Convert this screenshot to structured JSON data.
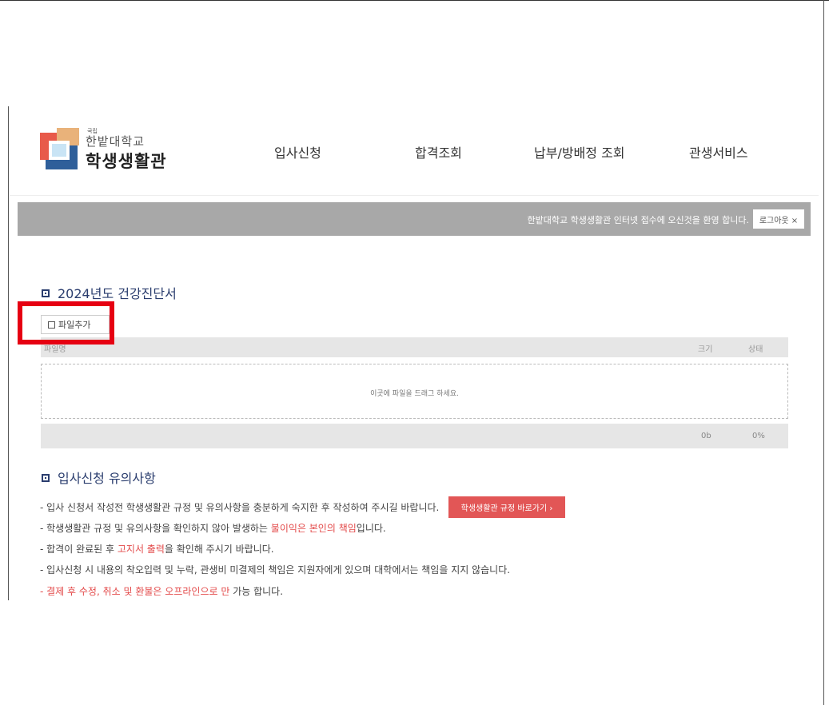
{
  "header": {
    "logo_small": "국립",
    "logo_university": "한밭대학교",
    "logo_title": "학생생활관",
    "nav": [
      "입사신청",
      "합격조회",
      "납부/방배정 조회",
      "관생서비스"
    ]
  },
  "banner": {
    "welcome": "한밭대학교 학생생활관 인터넷 접수에 오신것을 환영 합니다.",
    "logout_label": "로그아웃 ×"
  },
  "upload": {
    "title": "2024년도 건강진단서",
    "add_file_label": "파일추가",
    "columns": {
      "name": "파일명",
      "size": "크기",
      "status": "상태"
    },
    "drop_hint": "이곳에 파일을 드래그 하세요.",
    "total_size": "0b",
    "total_progress": "0%"
  },
  "notices": {
    "title": "입사신청 유의사항",
    "line1": "- 입사 신청서 작성전 학생생활관 규정 및 유의사항을 충분하게 숙지한 후 작성하여 주시길 바랍니다.",
    "rules_button": "학생생활관 규정 바로가기 ›",
    "line2_a": "- 학생생활관 규정 및 유의사항을 확인하지 않아 발생하는 ",
    "line2_red": "불이익은 본인의 책임",
    "line2_b": "입니다.",
    "line3_a": "- 합격이 완료된 후 ",
    "line3_red": "고지서 출력",
    "line3_b": "을 확인해 주시기 바랍니다.",
    "line4": "- 입사신청 시 내용의 착오입력 및 누락, 관생비 미결제의 책임은 지원자에게 있으며 대학에서는 책임을 지지 않습니다.",
    "line5_red": "- 결제 후 수정, 취소 및 환불은 오프라인으로 만",
    "line5_b": " 가능 합니다."
  },
  "colors": {
    "accent_navy": "#2a3d6e",
    "highlight_red": "#e60012",
    "notice_red": "#e34a4a",
    "banner_gray": "#a8a8a8"
  }
}
